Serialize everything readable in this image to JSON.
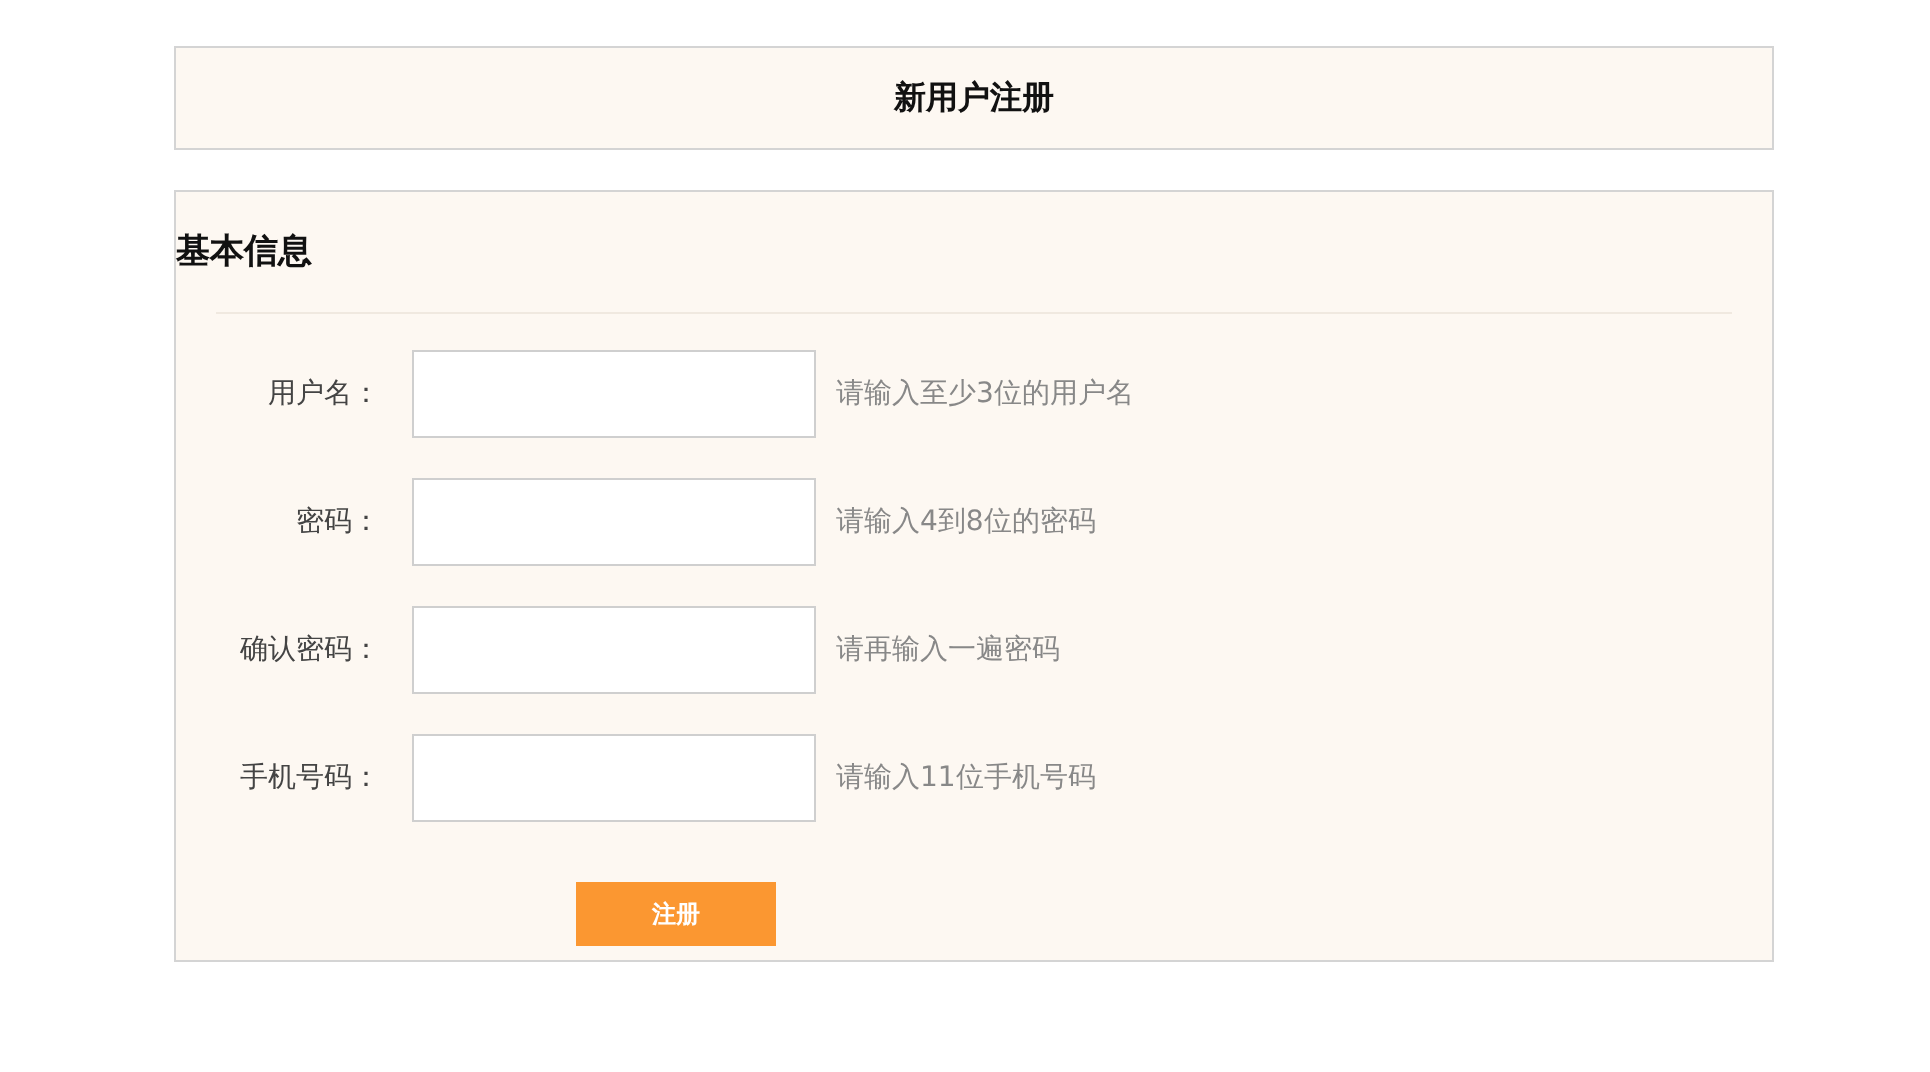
{
  "page_title": "新用户注册",
  "section": {
    "title": "基本信息"
  },
  "fields": [
    {
      "label": "用户名：",
      "hint": "请输入至少3位的用户名"
    },
    {
      "label": "密码：",
      "hint": "请输入4到8位的密码"
    },
    {
      "label": "确认密码：",
      "hint": "请再输入一遍密码"
    },
    {
      "label": "手机号码：",
      "hint": "请输入11位手机号码"
    }
  ],
  "submit_button": "注册"
}
